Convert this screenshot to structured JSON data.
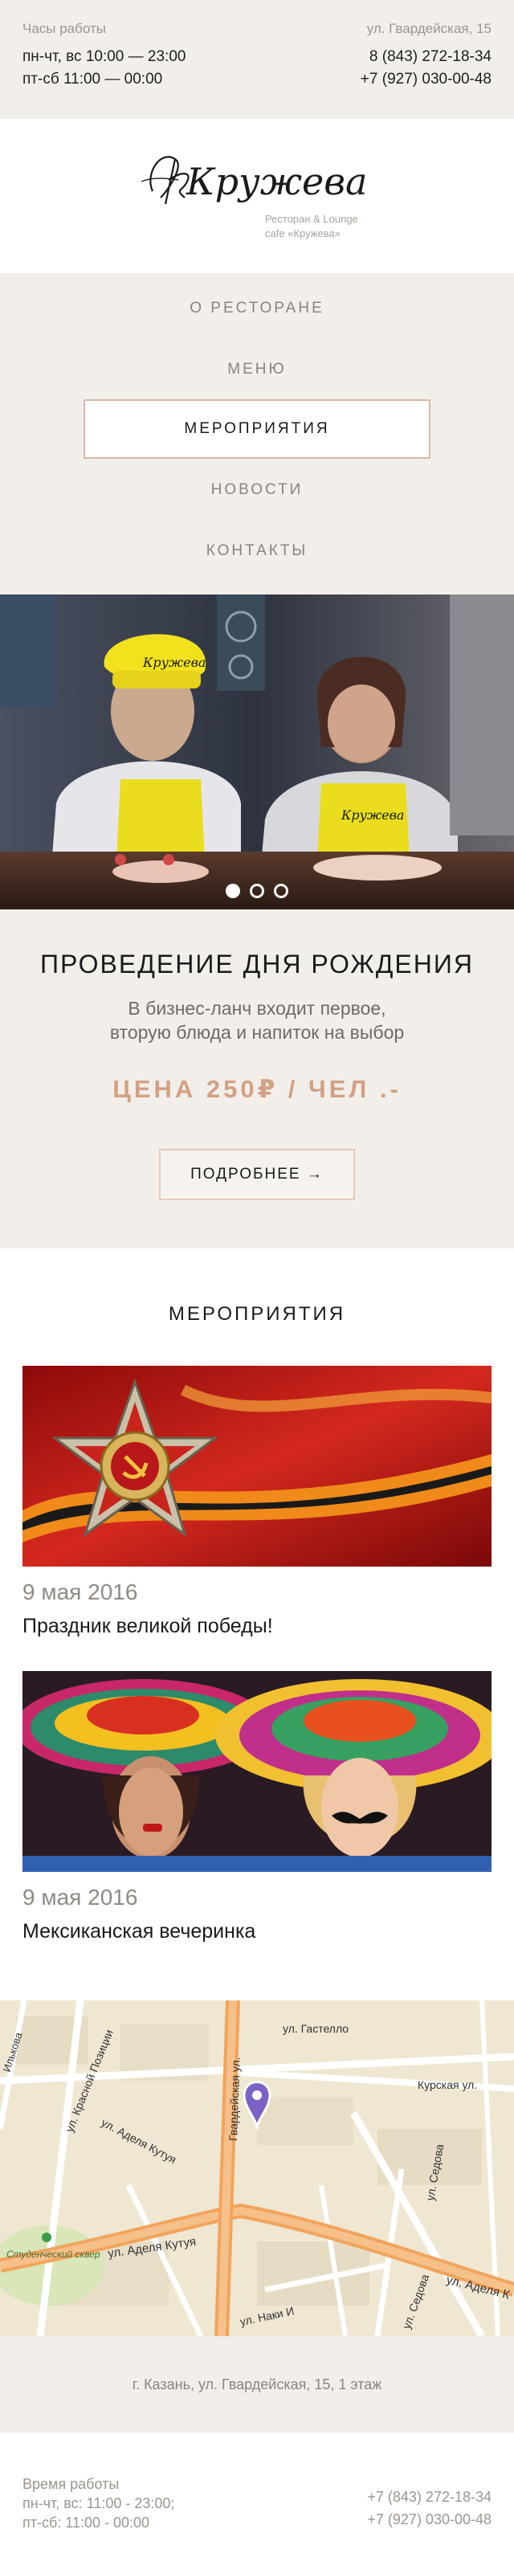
{
  "topbar": {
    "hours_title": "Часы работы",
    "hours_weekdays": "пн-чт, вс 10:00 — 23:00",
    "hours_weekend": "пт-сб 11:00 — 00:00",
    "address": "ул. Гвардейская, 15",
    "phone_1": "8 (843) 272-18-34",
    "phone_2": "+7 (927) 030-00-48"
  },
  "logo": {
    "name": "Кружева",
    "sub_line_1": "Ресторан & Lounge",
    "sub_line_2": "cafe «Кружева»"
  },
  "nav": {
    "items": [
      {
        "label": "О РЕСТОРАНЕ"
      },
      {
        "label": "МЕНЮ"
      },
      {
        "label": "МЕРОПРИЯТИЯ"
      },
      {
        "label": "НОВОСТИ"
      },
      {
        "label": "КОНТАКТЫ"
      }
    ]
  },
  "hero": {
    "cap_text": "Кружева",
    "apron_text": "Кружева",
    "slide_count": 3,
    "active_slide": 1
  },
  "promo": {
    "title": "ПРОВЕДЕНИЕ ДНЯ РОЖДЕНИЯ",
    "desc_line_1": "В бизнес-ланч входит первое,",
    "desc_line_2": "вторую блюда и напиток на выбор",
    "price": "ЦЕНА 250₽ / ЧЕЛ .-",
    "button": "ПОДРОБНЕЕ →"
  },
  "events": {
    "title": "МЕРОПРИЯТИЯ",
    "items": [
      {
        "date": "9 мая 2016",
        "name": "Праздник великой победы!"
      },
      {
        "date": "9 мая 2016",
        "name": "Мексиканская вечеринка"
      }
    ]
  },
  "map": {
    "streets": {
      "gastello": "ул. Гастелло",
      "kurskaya": "Курская ул.",
      "krasnoy_pozitsii": "ул. Красной Позиции",
      "adelya_kutuya_1": "ул. Аделя Кутуя",
      "adelya_kutuya_2": "ул. Аделя Кутуя",
      "adelya_kutuya_3": "ул. Аделя К",
      "gvardeyskaya": "Гвардейская ул.",
      "sedova_1": "ул. Седова",
      "sedova_2": "ул. Седова",
      "nika_i": "ул. Наки И",
      "studencheskiy": "Студенческий сквер",
      "ilkova": "Ильковa"
    }
  },
  "map_address": "г. Казань, ул. Гвардейская, 15, 1 этаж",
  "footer": {
    "work_title": "Время работы",
    "work_line_1": "пн-чт, вс: 11:00 - 23:00;",
    "work_line_2": "пт-сб: 11:00 - 00:00",
    "phone_1": "+7 (843) 272-18-34",
    "phone_2": "+7 (927) 030-00-48"
  },
  "colors": {
    "beige": "#f2efea",
    "accent": "#d2a183",
    "nav_border": "#d9b9a6",
    "pin": "#7b62c4"
  }
}
